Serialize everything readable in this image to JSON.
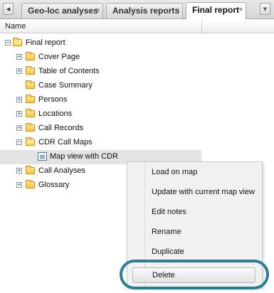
{
  "tabs": {
    "items": [
      {
        "label": "Geo-loc analyses"
      },
      {
        "label": "Analysis reports"
      },
      {
        "label": "Final report"
      }
    ],
    "close_glyph": "×",
    "prev_glyph": "◂",
    "next_glyph": "▾"
  },
  "column": {
    "name": "Name"
  },
  "tree": {
    "root": "Final report",
    "items": [
      {
        "label": "Cover Page"
      },
      {
        "label": "Table of Contents"
      },
      {
        "label": "Case Summary"
      },
      {
        "label": "Persons"
      },
      {
        "label": "Locations"
      },
      {
        "label": "Call Records"
      },
      {
        "label": "CDR Call Maps"
      },
      {
        "label": "Map view with CDR"
      },
      {
        "label": "Call Analyses"
      },
      {
        "label": "Glossary"
      }
    ],
    "expand_glyph": "+",
    "collapse_glyph": "−"
  },
  "context_menu": {
    "items": [
      {
        "label": "Load on map"
      },
      {
        "label": "Update with current map view"
      },
      {
        "label": "Edit notes"
      },
      {
        "label": "Rename"
      },
      {
        "label": "Duplicate"
      },
      {
        "label": "Delete"
      }
    ]
  },
  "colors": {
    "highlight_ring": "#2b7f93",
    "selected_row": "#e3e3e3",
    "folder": "#f3c54c"
  }
}
